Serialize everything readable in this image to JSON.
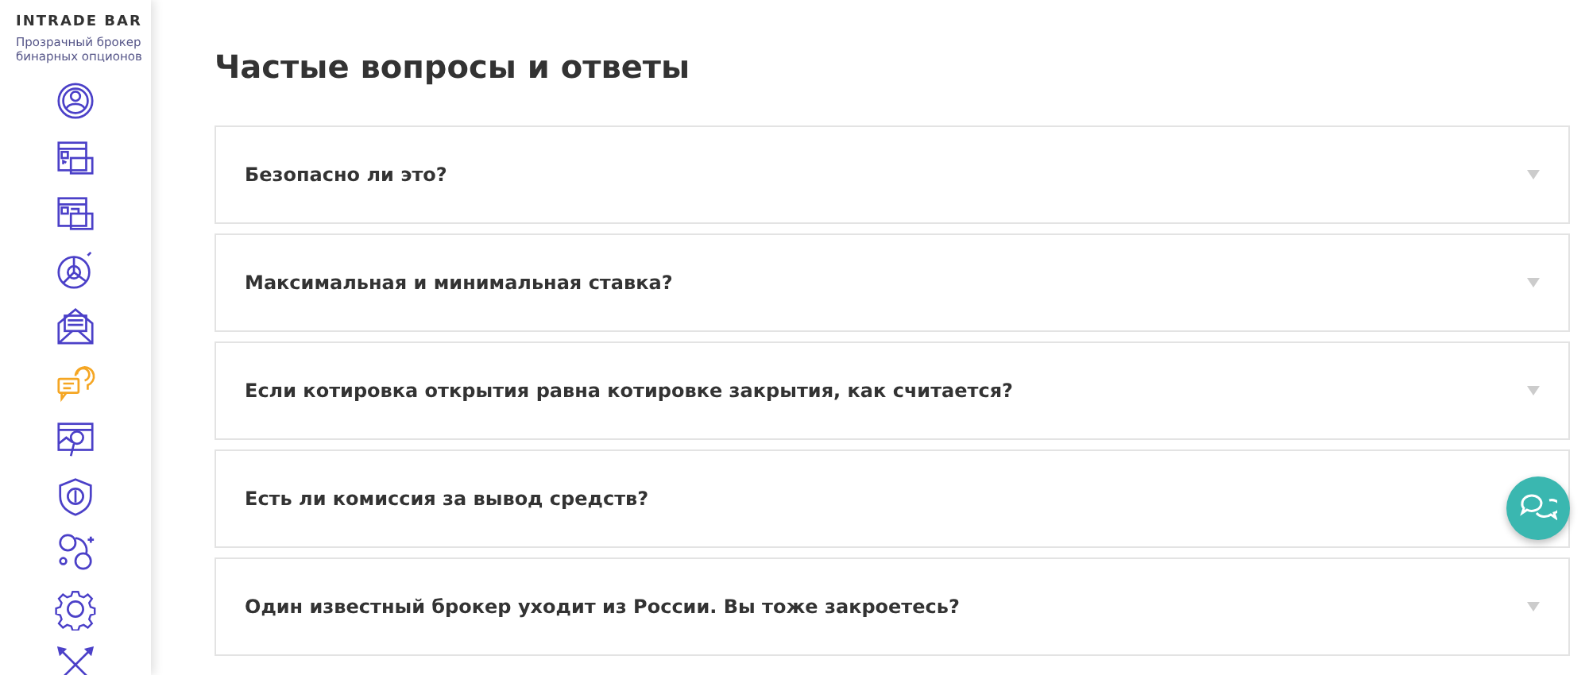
{
  "sidebar": {
    "logo": "INTRADE BAR",
    "tagline": "Прозрачный брокер бинарных опционов",
    "items": [
      {
        "kind": "profile",
        "selected": false
      },
      {
        "kind": "deposit",
        "selected": false
      },
      {
        "kind": "withdraw",
        "selected": false
      },
      {
        "kind": "stats",
        "selected": false
      },
      {
        "kind": "mail",
        "selected": false
      },
      {
        "kind": "faq",
        "selected": true
      },
      {
        "kind": "analysis",
        "selected": false
      },
      {
        "kind": "security",
        "selected": false
      },
      {
        "kind": "partners",
        "selected": false
      },
      {
        "kind": "settings",
        "selected": false
      },
      {
        "kind": "tournament",
        "selected": false
      }
    ]
  },
  "page_title": "Частые вопросы и ответы",
  "faq": [
    {
      "question": "Безопасно ли это?",
      "caret": true
    },
    {
      "question": "Максимальная и минимальная ставка?",
      "caret": true
    },
    {
      "question": "Если котировка открытия равна котировке закрытия, как считается?",
      "caret": true
    },
    {
      "question": "Есть ли комиссия за вывод средств?",
      "caret": false
    },
    {
      "question": "Один известный брокер уходит из России. Вы тоже закроетесь?",
      "caret": true
    }
  ]
}
